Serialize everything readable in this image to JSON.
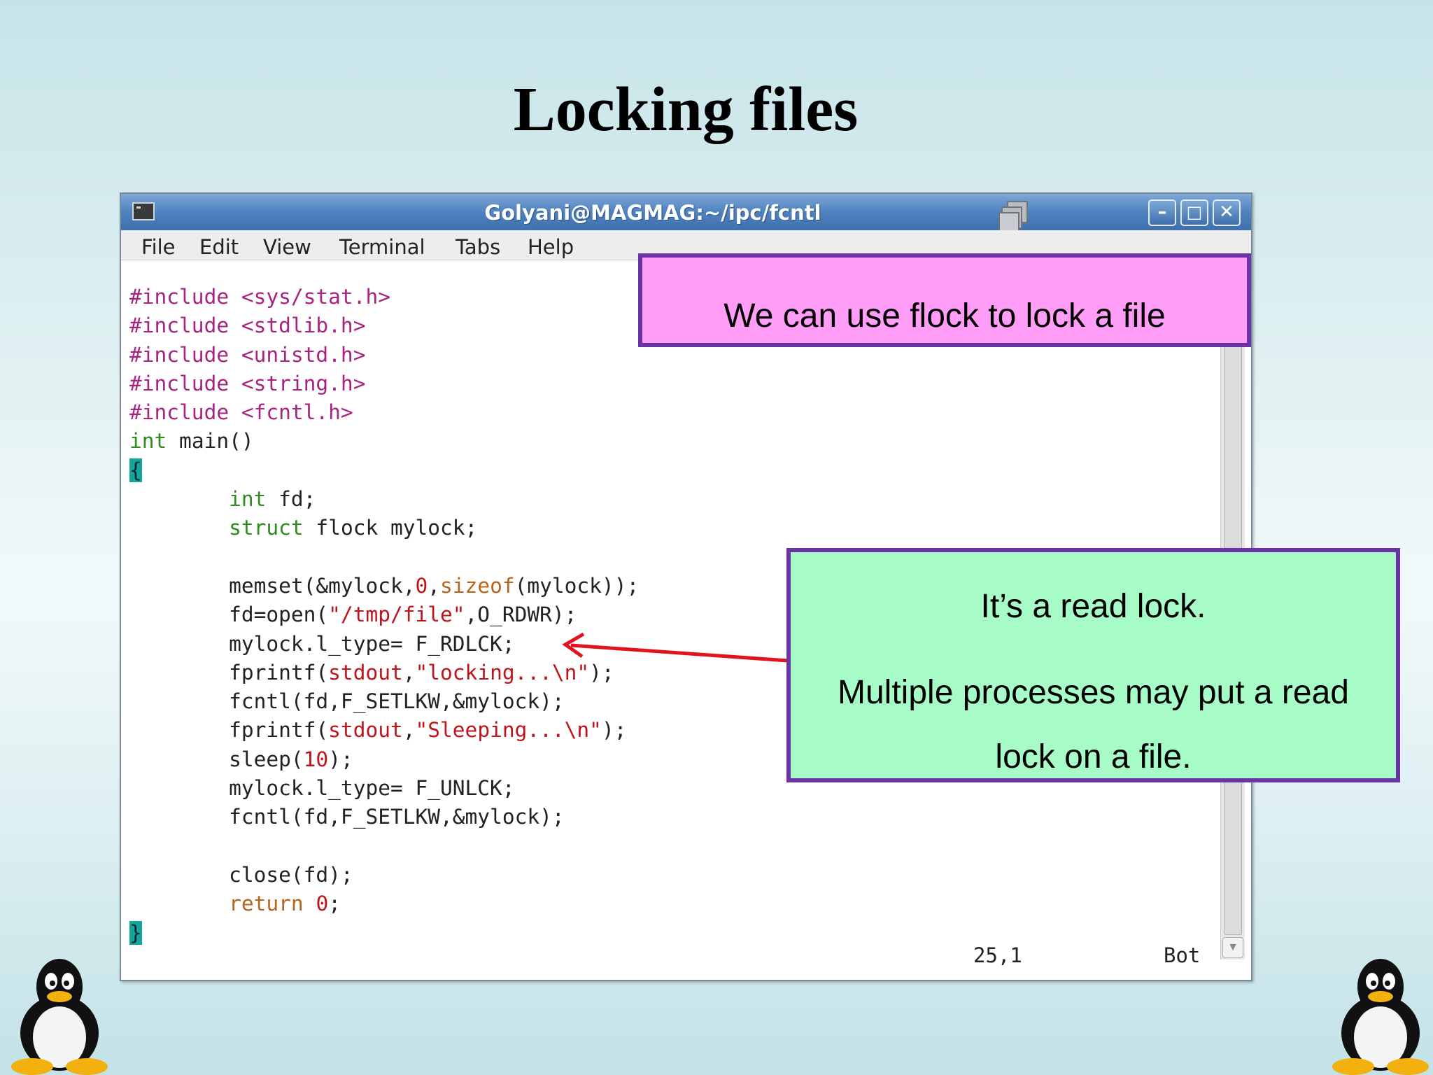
{
  "slide": {
    "title": "Locking files"
  },
  "window": {
    "title": "Golyani@MAGMAG:~/ipc/fcntl",
    "buttons": {
      "minimize": "–",
      "maximize": "□",
      "close": "✕"
    }
  },
  "menu": {
    "items": [
      "File",
      "Edit",
      "View",
      "Terminal",
      "Tabs",
      "Help"
    ]
  },
  "code": {
    "lines": [
      "#include <sys/stat.h>",
      "#include <stdlib.h>",
      "#include <unistd.h>",
      "#include <string.h>",
      "#include <fcntl.h>",
      "int main()",
      "{",
      "        int fd;",
      "        struct flock mylock;",
      "",
      "        memset(&mylock,0,sizeof(mylock));",
      "        fd=open(\"/tmp/file\",O_RDWR);",
      "        mylock.l_type= F_RDLCK;",
      "        fprintf(stdout,\"locking...\\n\");",
      "        fcntl(fd,F_SETLKW,&mylock);",
      "        fprintf(stdout,\"Sleeping...\\n\");",
      "        sleep(10);",
      "        mylock.l_type= F_UNLCK;",
      "        fcntl(fd,F_SETLKW,&mylock);",
      "",
      "        close(fd);",
      "        return 0;",
      "}"
    ]
  },
  "status": {
    "position": "25,1",
    "scroll": "Bot"
  },
  "callouts": {
    "top": "We can use flock to lock a file",
    "right_line1": "It’s a read lock.",
    "right_line2": "Multiple processes may put a read",
    "right_line3": "lock on a file."
  },
  "colors": {
    "keyword": "#2e8b1e",
    "preprocessor": "#a8237f",
    "string": "#c0141c",
    "callout_pink": "#ff9df7",
    "callout_green": "#a6fbc7",
    "callout_border": "#6a33a8",
    "arrow": "#e0141c"
  },
  "icons": {
    "terminal": "terminal-icon",
    "workspace": "window-stack-icon",
    "penguin": "tux-penguin-icon"
  }
}
